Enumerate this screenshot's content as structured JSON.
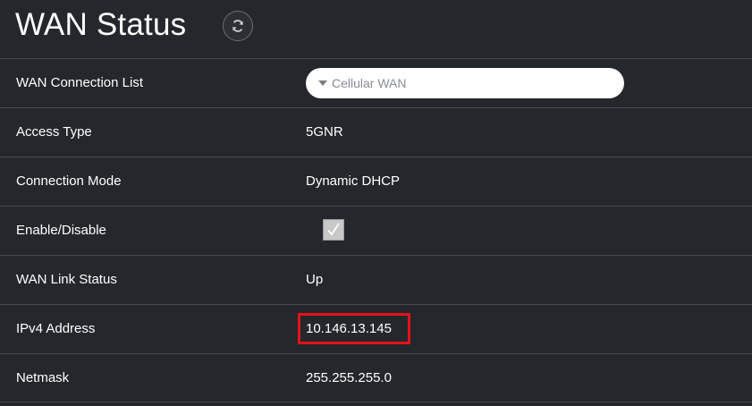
{
  "header": {
    "title": "WAN Status",
    "refresh_icon": "refresh-icon"
  },
  "rows": {
    "connection_list": {
      "label": "WAN Connection List",
      "selected": "Cellular WAN"
    },
    "access_type": {
      "label": "Access Type",
      "value": "5GNR"
    },
    "connection_mode": {
      "label": "Connection Mode",
      "value": "Dynamic DHCP"
    },
    "enable_disable": {
      "label": "Enable/Disable",
      "checked": true
    },
    "link_status": {
      "label": "WAN Link Status",
      "value": "Up"
    },
    "ipv4": {
      "label": "IPv4 Address",
      "value": "10.146.13.145"
    },
    "netmask": {
      "label": "Netmask",
      "value": "255.255.255.0"
    }
  },
  "colors": {
    "background": "#24272b",
    "divider": "#45494e",
    "highlight": "#e3121b"
  }
}
